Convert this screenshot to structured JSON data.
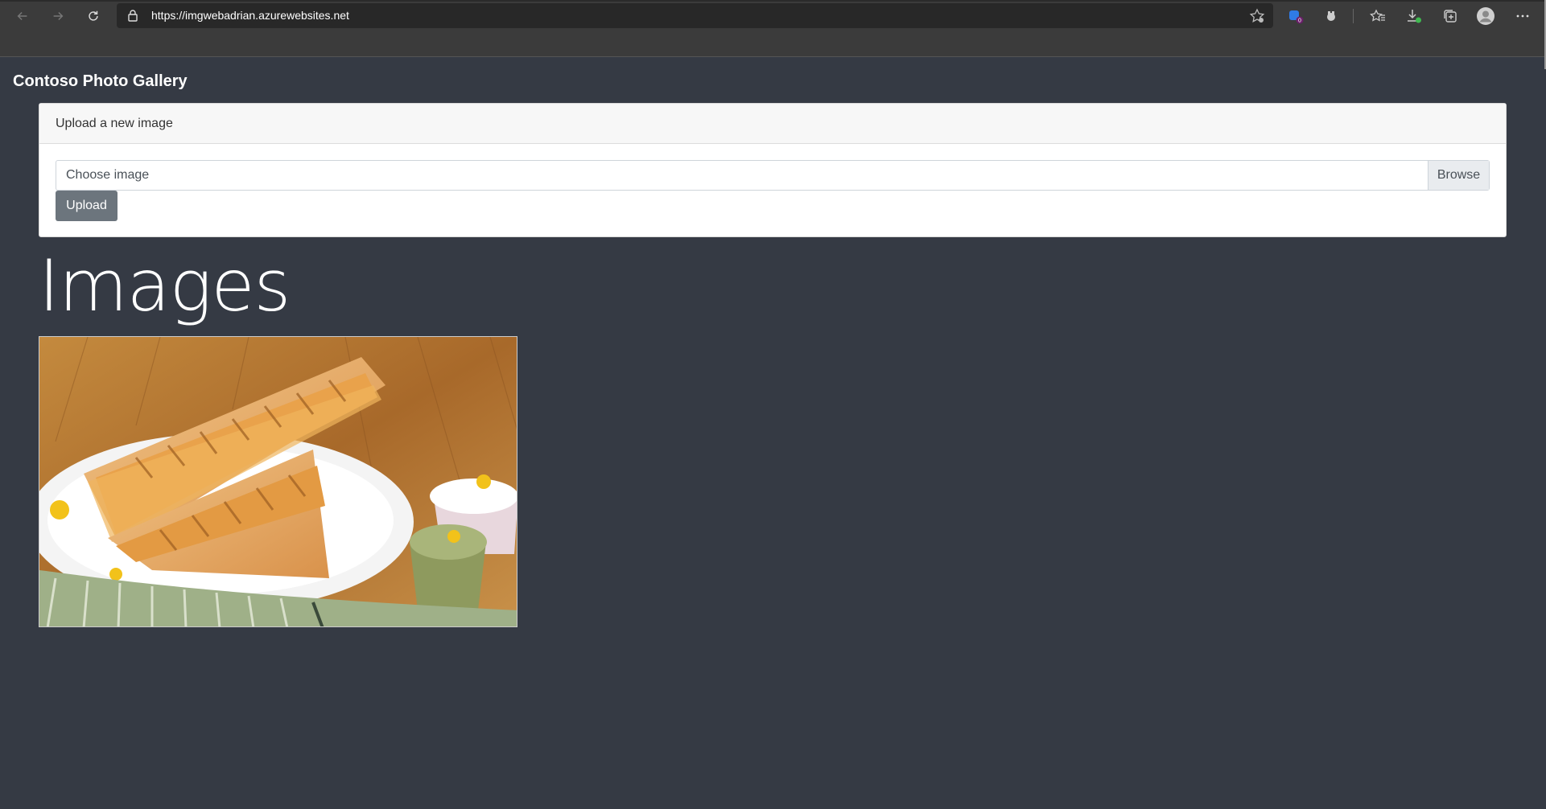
{
  "browser": {
    "url": "https://imgwebadrian.azurewebsites.net",
    "back_icon": "arrow-left-icon",
    "forward_icon": "arrow-right-icon",
    "refresh_icon": "refresh-icon",
    "lock_icon": "lock-icon",
    "toolbar_icons": [
      "favorite-add-icon",
      "extension-badge-icon",
      "extension-icon",
      "favorites-icon",
      "downloads-icon",
      "collections-icon",
      "profile-avatar-icon",
      "more-icon"
    ],
    "extension_badge": "0"
  },
  "app": {
    "brand": "Contoso Photo Gallery",
    "upload_card": {
      "title": "Upload a new image",
      "file_placeholder": "Choose image",
      "browse_label": "Browse",
      "upload_label": "Upload"
    },
    "images_heading": "Images",
    "images": [
      {
        "description": "grilled cheese corn sandwich with dips"
      }
    ]
  },
  "colors": {
    "page_bg": "#353a44",
    "upload_button": "#6c757d"
  }
}
